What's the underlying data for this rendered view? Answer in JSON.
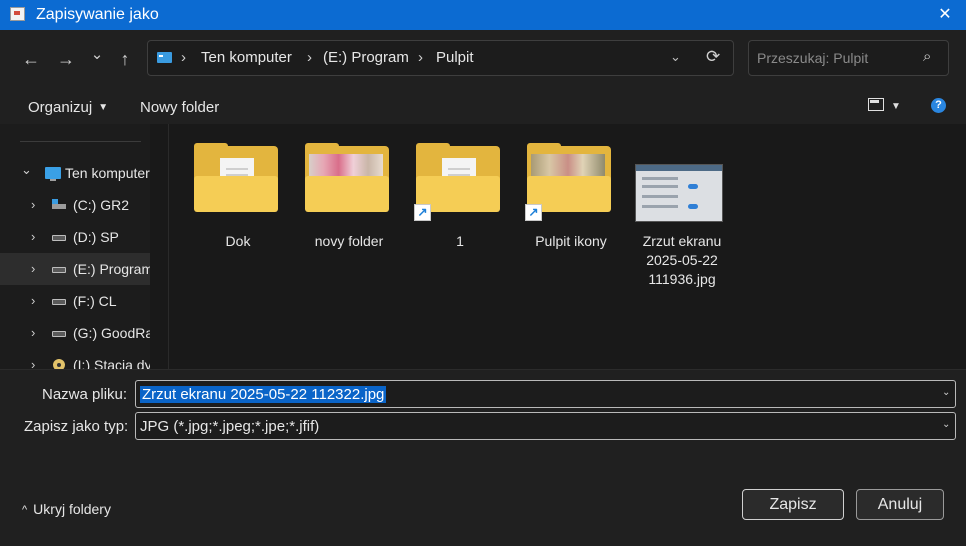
{
  "window": {
    "title": "Zapisywanie jako",
    "close_glyph": "✕"
  },
  "nav": {
    "back_glyph": "←",
    "forward_glyph": "→",
    "recent_glyph": "⌄",
    "up_glyph": "↑",
    "breadcrumbs": [
      "Ten komputer",
      "(E:) Program",
      "Pulpit"
    ],
    "crumb_separator": "›",
    "dropdown_glyph": "⌄",
    "refresh_glyph": "⟳",
    "search_placeholder": "Przeszukaj: Pulpit",
    "search_icon_glyph": "⌕"
  },
  "commands": {
    "organize": "Organizuj",
    "new_folder": "Nowy folder",
    "caret_glyph": "▼",
    "help_glyph": "?"
  },
  "sidebar": {
    "items": [
      {
        "label": "Ten komputer",
        "expander": "⌄",
        "icon": "pc-icon"
      },
      {
        "label": "(C:) GR2",
        "expander": "›",
        "icon": "system-drive-icon"
      },
      {
        "label": "(D:) SP",
        "expander": "›",
        "icon": "drive-icon"
      },
      {
        "label": "(E:) Program",
        "expander": "›",
        "icon": "drive-icon"
      },
      {
        "label": "(F:) CL",
        "expander": "›",
        "icon": "drive-icon"
      },
      {
        "label": "(G:) GoodRa",
        "expander": "›",
        "icon": "drive-icon"
      },
      {
        "label": "(I:) Stacja dy",
        "expander": "›",
        "icon": "cd-drive-icon"
      }
    ]
  },
  "files": [
    {
      "name": "Dok",
      "type": "folder",
      "icon": "folder-icon"
    },
    {
      "name": "novy folder",
      "type": "folder",
      "icon": "folder-icon"
    },
    {
      "name": "1",
      "type": "folder-shortcut",
      "icon": "folder-shortcut-icon"
    },
    {
      "name": "Pulpit ikony",
      "type": "folder-shortcut",
      "icon": "folder-shortcut-icon"
    },
    {
      "name": "Zrzut ekranu 2025-05-22 111936.jpg",
      "name_lines": [
        "Zrzut ekranu",
        "2025-05-22",
        "111936.jpg"
      ],
      "type": "image",
      "icon": "image-thumbnail"
    }
  ],
  "form": {
    "filename_label": "Nazwa pliku:",
    "filename_value": "Zrzut ekranu 2025-05-22 112322.jpg",
    "filetype_label": "Zapisz jako typ:",
    "filetype_value": "JPG (*.jpg;*.jpeg;*.jpe;*.jfif)",
    "caret_glyph": "⌄"
  },
  "footer": {
    "hide_folders": "Ukryj foldery",
    "hide_chevron": "^",
    "save": "Zapisz",
    "cancel": "Anuluj"
  },
  "colors": {
    "accent": "#0c6bd2",
    "background": "#191919",
    "folder": "#f5cd55",
    "selection": "#0a64c8"
  }
}
